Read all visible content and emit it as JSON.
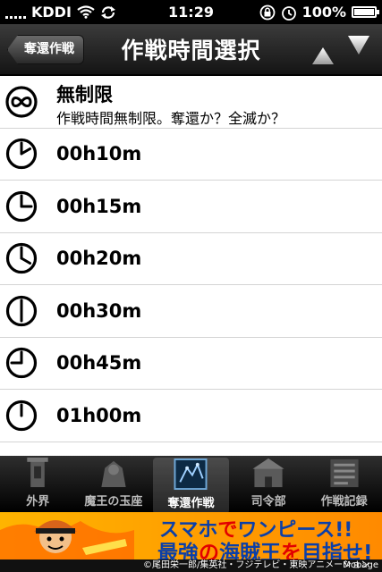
{
  "status_bar": {
    "carrier": "KDDI",
    "time": "11:29",
    "battery": "100%",
    "battery_level": 1.0,
    "icons": [
      "signal-icon",
      "wifi-icon",
      "sync-icon",
      "rotation-lock-icon",
      "alarm-icon",
      "battery-icon"
    ]
  },
  "nav_bar": {
    "back_label": "奪還作戦",
    "title": "作戦時間選択",
    "up_icon": "arrow-up-icon",
    "down_icon": "arrow-down-icon"
  },
  "list": {
    "first": {
      "title": "無制限",
      "subtitle": "作戦時間無制限。奪還か？全滅か？",
      "icon": "infinity-icon"
    },
    "items": [
      {
        "label": "00h10m",
        "icon": "clock-icon",
        "minute_angle": 60
      },
      {
        "label": "00h15m",
        "icon": "clock-icon",
        "minute_angle": 90
      },
      {
        "label": "00h20m",
        "icon": "clock-icon",
        "minute_angle": 120
      },
      {
        "label": "00h30m",
        "icon": "clock-icon",
        "minute_angle": 180
      },
      {
        "label": "00h45m",
        "icon": "clock-icon",
        "minute_angle": 270
      },
      {
        "label": "01h00m",
        "icon": "clock-icon",
        "minute_angle": 0
      }
    ]
  },
  "tab_bar": {
    "tabs": [
      {
        "label": "外界",
        "active": false
      },
      {
        "label": "魔王の玉座",
        "active": false
      },
      {
        "label": "奪還作戦",
        "active": true
      },
      {
        "label": "司令部",
        "active": false
      },
      {
        "label": "作戦記録",
        "active": false
      }
    ]
  },
  "ad": {
    "line1_a": "スマホ",
    "line1_b": "で",
    "line1_c": "ワンピース!!",
    "line2_a": "最強",
    "line2_b": "の",
    "line2_c": "海賊王",
    "line2_d": "を",
    "line2_e": "目指せ!",
    "credit": "©尾田栄一郎/集英社・フジテレビ・東映アニメーション ©NBGI",
    "brand": "Mobage",
    "colors": {
      "bg": "#ffb400",
      "text": "#0b3fa8",
      "accent": "#e20000"
    }
  }
}
